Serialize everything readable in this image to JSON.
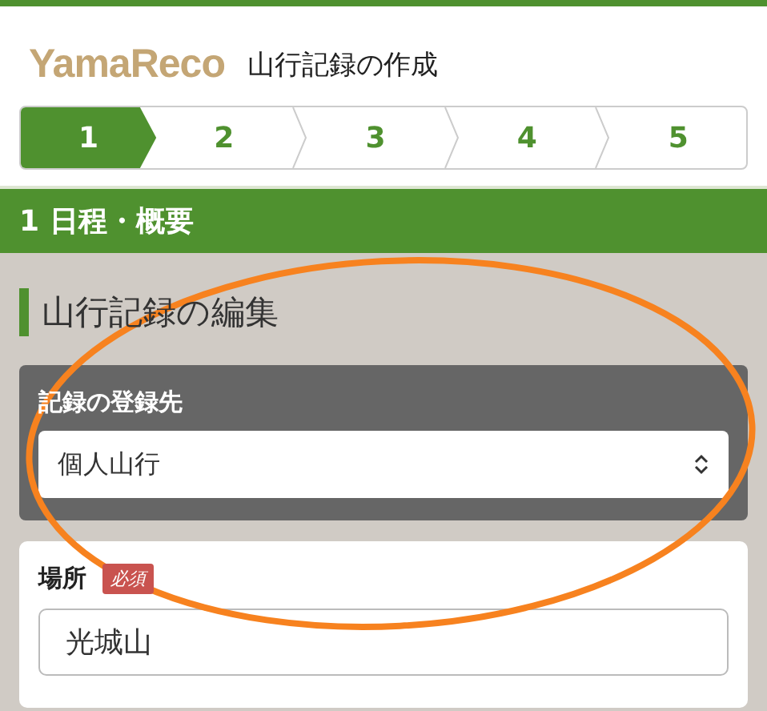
{
  "header": {
    "logo": "YamaReco",
    "title": "山行記録の作成"
  },
  "steps": [
    {
      "label": "1",
      "selected": true
    },
    {
      "label": "2",
      "selected": false
    },
    {
      "label": "3",
      "selected": false
    },
    {
      "label": "4",
      "selected": false
    },
    {
      "label": "5",
      "selected": false
    }
  ],
  "section_bar": "1 日程・概要",
  "heading": "山行記録の編集",
  "destination": {
    "label": "記録の登録先",
    "value": "個人山行"
  },
  "place": {
    "label": "場所",
    "badge": "必須",
    "value": "光城山"
  },
  "annotation": {
    "kind": "ellipse"
  }
}
